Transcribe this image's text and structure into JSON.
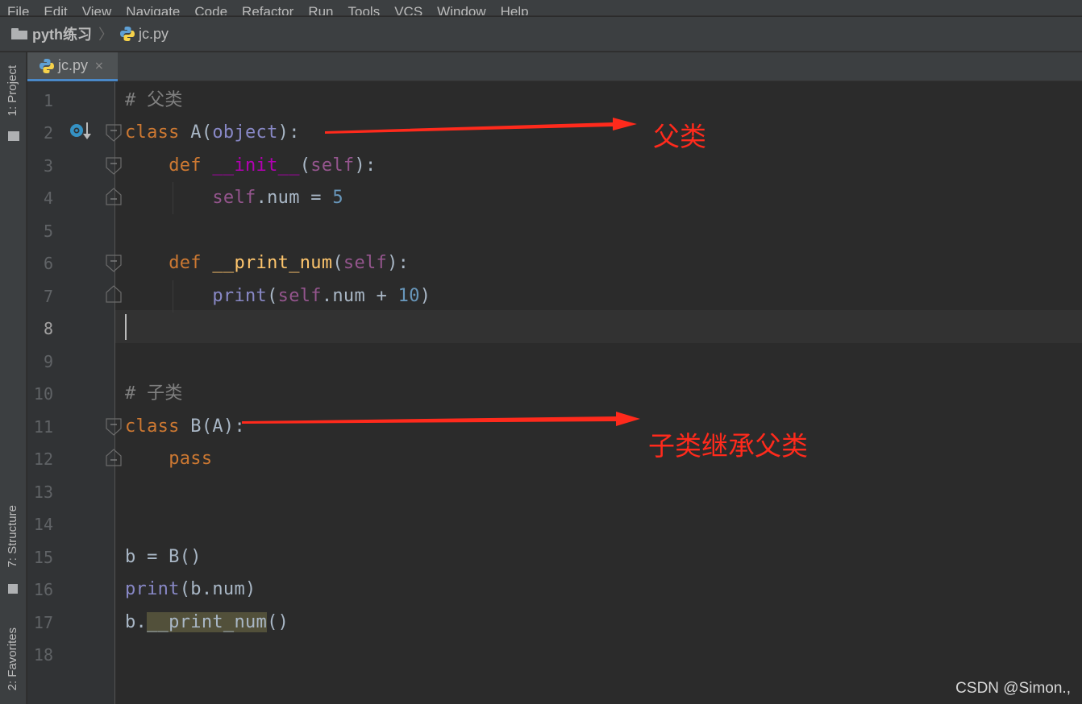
{
  "menu": [
    "File",
    "Edit",
    "View",
    "Navigate",
    "Code",
    "Refactor",
    "Run",
    "Tools",
    "VCS",
    "Window",
    "Help"
  ],
  "breadcrumb": {
    "project": "pyth练习",
    "file": "jc.py"
  },
  "tool_windows": {
    "project": "1: Project",
    "structure": "7: Structure",
    "favorites": "2: Favorites"
  },
  "editor_tab": {
    "label": "jc.py",
    "close": "×"
  },
  "line_numbers": [
    "1",
    "2",
    "3",
    "4",
    "5",
    "6",
    "7",
    "8",
    "9",
    "10",
    "11",
    "12",
    "13",
    "14",
    "15",
    "16",
    "17",
    "18"
  ],
  "current_line": "8",
  "code": {
    "l1": {
      "comment": "# 父类"
    },
    "l2": {
      "kw": "class",
      "name": " A(",
      "base": "object",
      "end": "):"
    },
    "l3": {
      "indent": "    ",
      "kw": "def",
      "sp": " ",
      "magic": "__init__",
      "open": "(",
      "self": "self",
      "close": "):"
    },
    "l4": {
      "indent": "        ",
      "self": "self",
      "rest": ".num = ",
      "num": "5"
    },
    "l6": {
      "indent": "    ",
      "kw": "def",
      "sp": " ",
      "fn": "__print_num",
      "open": "(",
      "self": "self",
      "close": "):"
    },
    "l7": {
      "indent": "        ",
      "builtin": "print",
      "open": "(",
      "self": "self",
      "rest": ".num + ",
      "num": "10",
      "close": ")"
    },
    "l10": {
      "comment": "# 子类"
    },
    "l11": {
      "kw": "class",
      "rest": " B(A):"
    },
    "l12": {
      "indent": "    ",
      "kw": "pass"
    },
    "l15": {
      "text": "b = B()"
    },
    "l16": {
      "builtin": "print",
      "rest": "(b.num)"
    },
    "l17": {
      "pre": "b.",
      "hl": "__print_num",
      "post": "()"
    }
  },
  "annotations": {
    "parent": "父类",
    "child": "子类继承父类"
  },
  "colors": {
    "arrow": "#ff2a1c",
    "keyword": "#cc7832",
    "self": "#94558d",
    "number": "#6897bb",
    "comment": "#808080"
  },
  "watermark": "CSDN @Simon.,"
}
